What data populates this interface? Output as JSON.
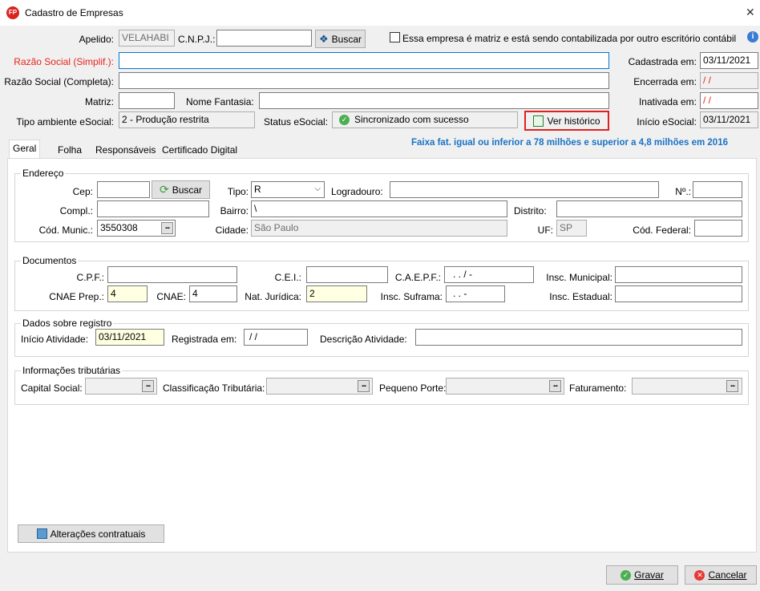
{
  "window": {
    "app_icon": "FP",
    "title": "Cadastro de Empresas",
    "close": "✕"
  },
  "header": {
    "apelido_label": "Apelido:",
    "apelido_value": "VELAHABI",
    "cnpj_label": "C.N.P.J.:",
    "cnpj_value": "",
    "buscar_label": "Buscar",
    "matriz_check_label": "Essa empresa é matriz e está sendo contabilizada por outro escritório contábil",
    "razao_simplif_label": "Razão Social (Simplif.):",
    "razao_completa_label": "Razão Social (Completa):",
    "matriz_label": "Matriz:",
    "nome_fantasia_label": "Nome Fantasia:",
    "tipo_ambiente_label": "Tipo ambiente eSocial:",
    "tipo_ambiente_value": "2 - Produção restrita",
    "status_label": "Status eSocial:",
    "status_value": "Sincronizado com sucesso",
    "ver_historico_label": "Ver histórico",
    "cadastrada_label": "Cadastrada em:",
    "cadastrada_value": "03/11/2021",
    "encerrada_label": "Encerrada em:",
    "encerrada_value": "/ /",
    "inativada_label": "Inativada em:",
    "inativada_value": "/ /",
    "inicio_esocial_label": "Início eSocial:",
    "inicio_esocial_value": "03/11/2021"
  },
  "tabs": [
    "Geral",
    "Folha",
    "Responsáveis",
    "Certificado Digital"
  ],
  "notice": "Faixa fat. igual ou inferior a 78 milhões e superior a 4,8 milhões em 2016",
  "endereco": {
    "title": "Endereço",
    "cep_label": "Cep:",
    "cep_value": "",
    "buscar_label": "Buscar",
    "tipo_label": "Tipo:",
    "tipo_value": "R",
    "logradouro_label": "Logradouro:",
    "logradouro_value": "",
    "numero_label": "Nº.:",
    "compl_label": "Compl.:",
    "bairro_label": "Bairro:",
    "bairro_value": "\\",
    "distrito_label": "Distrito:",
    "cod_munic_label": "Cód. Munic.:",
    "cod_munic_value": "3550308",
    "cidade_label": "Cidade:",
    "cidade_value": "São Paulo",
    "uf_label": "UF:",
    "uf_value": "SP",
    "cod_federal_label": "Cód. Federal:"
  },
  "documentos": {
    "title": "Documentos",
    "cpf_label": "C.P.F.:",
    "cei_label": "C.E.I.:",
    "caepf_label": "C.A.E.P.F.:",
    "caepf_value": ".   .   /   -",
    "insc_municipal_label": "Insc. Municipal:",
    "cnae_prep_label": "CNAE Prep.:",
    "cnae_prep_value": "4",
    "cnae_label": "CNAE:",
    "cnae_value": "4",
    "nat_juridica_label": "Nat. Jurídica:",
    "nat_juridica_value": "2",
    "insc_suframa_label": "Insc. Suframa:",
    "insc_suframa_value": ".   .  -",
    "insc_estadual_label": "Insc. Estadual:"
  },
  "registro": {
    "title": "Dados sobre registro",
    "inicio_label": "Início Atividade:",
    "inicio_value": "03/11/2021",
    "registrada_label": "Registrada em:",
    "registrada_value": "/ /",
    "descricao_label": "Descrição Atividade:"
  },
  "tributarias": {
    "title": "Informações tributárias",
    "capital_label": "Capital Social:",
    "classificacao_label": "Classificação Tributária:",
    "pequeno_label": "Pequeno Porte:",
    "faturamento_label": "Faturamento:"
  },
  "footer": {
    "alteracoes_label": "Alterações contratuais",
    "gravar_label": "Gravar",
    "cancelar_label": "Cancelar"
  }
}
